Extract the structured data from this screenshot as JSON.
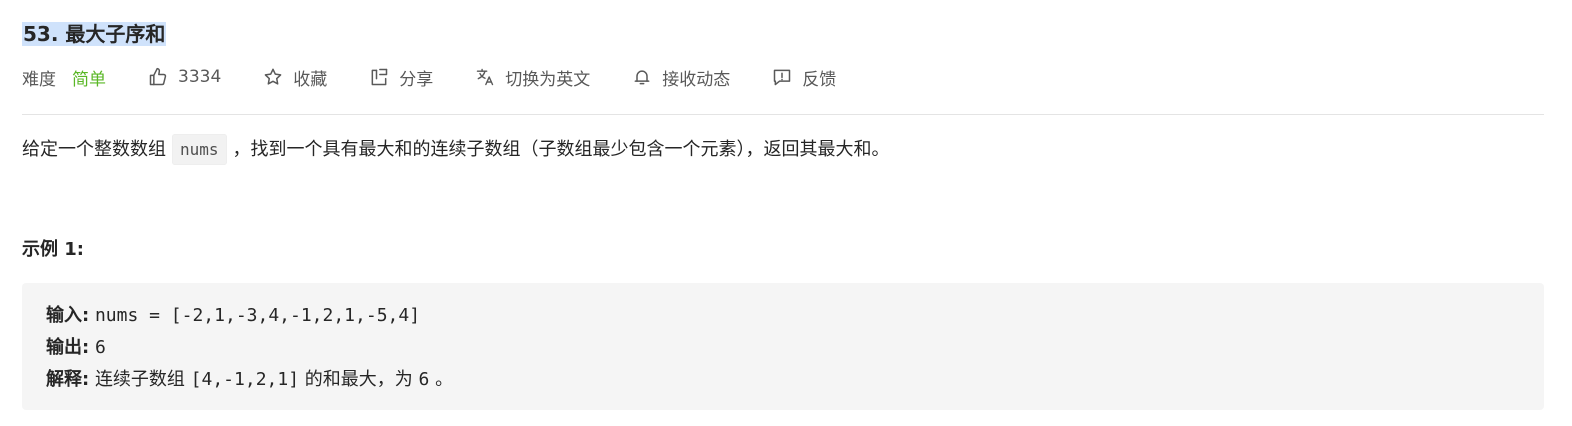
{
  "problem": {
    "title": "53. 最大子序和"
  },
  "meta": {
    "difficulty_label": "难度",
    "difficulty_value": "简单",
    "likes": "3334",
    "favorite_label": "收藏",
    "share_label": "分享",
    "translate_label": "切换为英文",
    "subscribe_label": "接收动态",
    "feedback_label": "反馈",
    "difficulty_color": "#5ab726"
  },
  "description": {
    "text_before": "给定一个整数数组",
    "code": "nums",
    "text_after": "，找到一个具有最大和的连续子数组（子数组最少包含一个元素），返回其最大和。"
  },
  "example": {
    "heading": "示例 1:",
    "input_label": "输入:",
    "input_value": "nums = [-2,1,-3,4,-1,2,1,-5,4]",
    "output_label": "输出:",
    "output_value": "6",
    "explanation_label": "解释:",
    "explanation_text_1": "连续子数组",
    "explanation_code": "[4,-1,2,1]",
    "explanation_text_2": "的和最大，为",
    "explanation_num": "6",
    "explanation_text_3": "。"
  },
  "icons": {
    "like": "thumbs-up-icon",
    "favorite": "star-icon",
    "share": "share-icon",
    "translate": "translate-icon",
    "subscribe": "bell-icon",
    "feedback": "feedback-icon"
  }
}
